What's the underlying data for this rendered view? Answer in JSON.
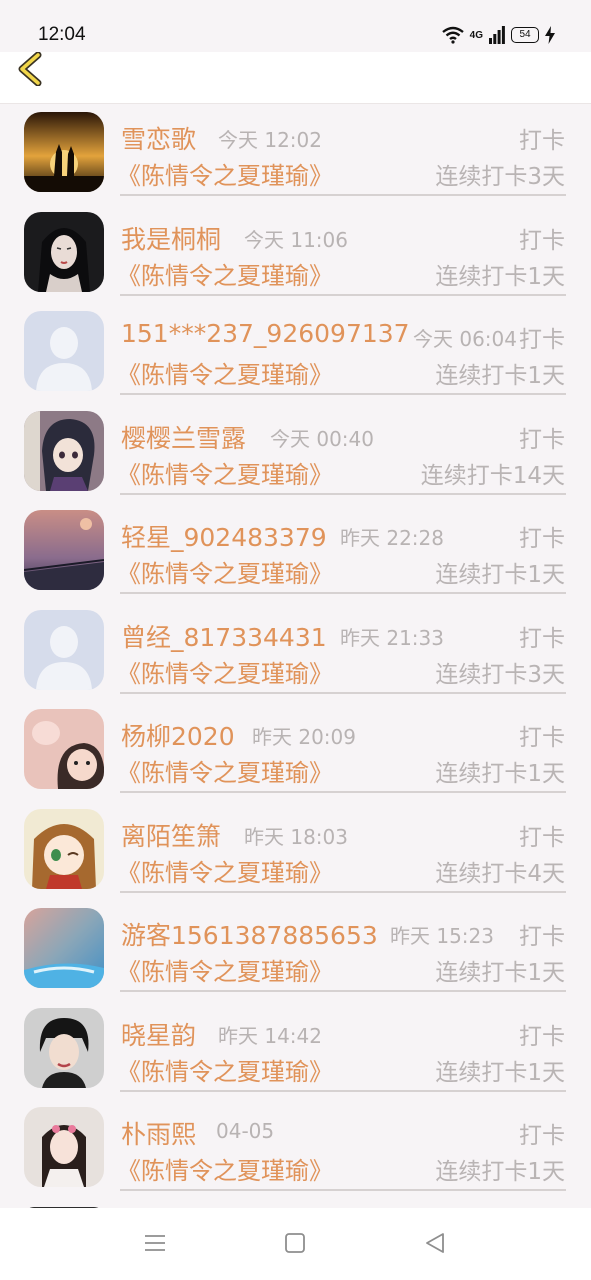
{
  "status_bar": {
    "time": "12:04",
    "network": "4G",
    "battery": "54"
  },
  "colors": {
    "accent": "#e0935a",
    "muted": "#b9b4b4",
    "background": "#f7f4f6"
  },
  "nav": {
    "back_icon": "chevron-left-icon"
  },
  "entries": [
    {
      "name": "雪恋歌",
      "time": "今天 12:02",
      "tag": "打卡",
      "book": "《陈情令之夏瑾瑜》",
      "streak": "连续打卡3天"
    },
    {
      "name": "我是桐桐",
      "time": "今天 11:06",
      "tag": "打卡",
      "book": "《陈情令之夏瑾瑜》",
      "streak": "连续打卡1天"
    },
    {
      "name": "151***237_926097137",
      "time": "今天 06:04",
      "tag": "打卡",
      "book": "《陈情令之夏瑾瑜》",
      "streak": "连续打卡1天"
    },
    {
      "name": "樱樱兰雪露",
      "time": "今天 00:40",
      "tag": "打卡",
      "book": "《陈情令之夏瑾瑜》",
      "streak": "连续打卡14天"
    },
    {
      "name": "轻星_902483379",
      "time": "昨天 22:28",
      "tag": "打卡",
      "book": "《陈情令之夏瑾瑜》",
      "streak": "连续打卡1天"
    },
    {
      "name": "曾经_817334431",
      "time": "昨天 21:33",
      "tag": "打卡",
      "book": "《陈情令之夏瑾瑜》",
      "streak": "连续打卡3天"
    },
    {
      "name": "杨柳2020",
      "time": "昨天 20:09",
      "tag": "打卡",
      "book": "《陈情令之夏瑾瑜》",
      "streak": "连续打卡1天"
    },
    {
      "name": "离陌笙箫",
      "time": "昨天 18:03",
      "tag": "打卡",
      "book": "《陈情令之夏瑾瑜》",
      "streak": "连续打卡4天"
    },
    {
      "name": "游客1561387885653",
      "time": "昨天 15:23",
      "tag": "打卡",
      "book": "《陈情令之夏瑾瑜》",
      "streak": "连续打卡1天"
    },
    {
      "name": "晓星韵",
      "time": "昨天 14:42",
      "tag": "打卡",
      "book": "《陈情令之夏瑾瑜》",
      "streak": "连续打卡1天"
    },
    {
      "name": "朴雨熙",
      "time": "04-05",
      "tag": "打卡",
      "book": "《陈情令之夏瑾瑜》",
      "streak": "连续打卡1天"
    }
  ],
  "system_nav": {
    "menu_icon": "menu-icon",
    "home_icon": "home-square-icon",
    "back_icon": "back-triangle-icon"
  }
}
